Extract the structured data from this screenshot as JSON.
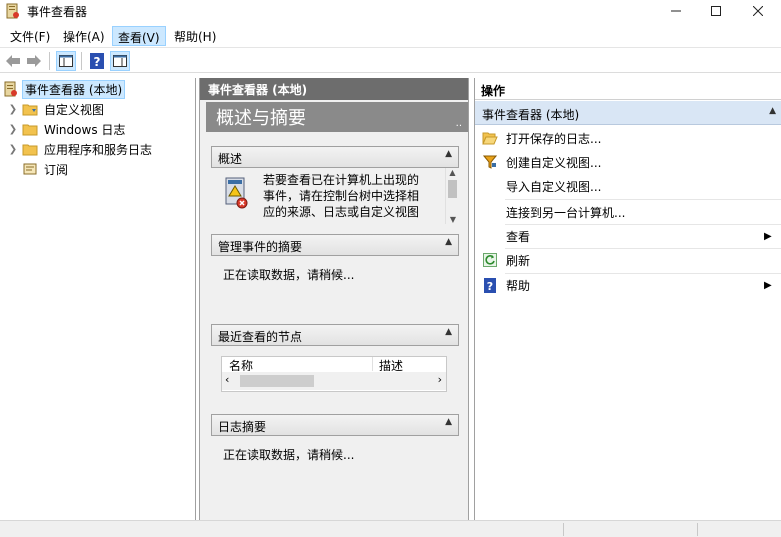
{
  "window": {
    "title": "事件查看器"
  },
  "menu": {
    "file": "文件(F)",
    "action": "操作(A)",
    "view": "查看(V)",
    "help": "帮助(H)"
  },
  "tree": {
    "root": "事件查看器 (本地)",
    "items": [
      "自定义视图",
      "Windows 日志",
      "应用程序和服务日志",
      "订阅"
    ]
  },
  "center": {
    "header": "事件查看器 (本地)",
    "banner": "概述与摘要",
    "banner_grip": "..",
    "overview": {
      "title": "概述",
      "lines": [
        "若要查看已在计算机上出现的",
        "事件，请在控制台树中选择相",
        "应的来源、日志或自定义视图"
      ]
    },
    "admin_summary": {
      "title": "管理事件的摘要",
      "status": "正在读取数据，请稍候..."
    },
    "recent_nodes": {
      "title": "最近查看的节点",
      "col_name": "名称",
      "col_desc": "描述"
    },
    "log_summary": {
      "title": "日志摘要",
      "status": "正在读取数据，请稍候..."
    }
  },
  "actions": {
    "header": "操作",
    "section": "事件查看器 (本地)",
    "items": [
      "打开保存的日志...",
      "创建自定义视图...",
      "导入自定义视图...",
      "连接到另一台计算机...",
      "查看",
      "刷新",
      "帮助"
    ]
  }
}
